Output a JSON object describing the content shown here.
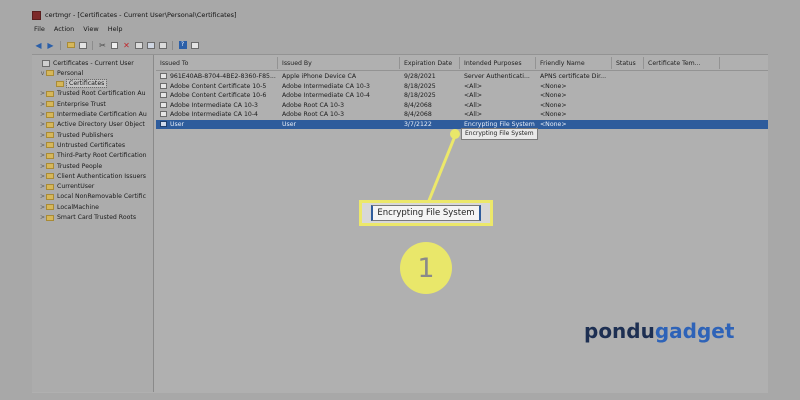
{
  "window": {
    "title": "certmgr - [Certificates - Current User\\Personal\\Certificates]",
    "menu": [
      "File",
      "Action",
      "View",
      "Help"
    ]
  },
  "toolbar_icons": [
    "back-icon",
    "forward-icon",
    "up-folder-icon",
    "show-hide-tree-icon",
    "cut-icon",
    "copy-icon",
    "delete-icon",
    "properties-icon",
    "refresh-icon",
    "export-icon",
    "help-icon",
    "view-icon"
  ],
  "tree": [
    {
      "label": "Certificates - Current User",
      "level": 0,
      "expander": "",
      "icon": "certificate-store-icon"
    },
    {
      "label": "Personal",
      "level": 1,
      "expander": "v",
      "icon": "folder-icon"
    },
    {
      "label": "Certificates",
      "level": 2,
      "expander": "",
      "icon": "folder-icon",
      "selected": true
    },
    {
      "label": "Trusted Root Certification Au",
      "level": 1,
      "expander": ">",
      "icon": "folder-icon"
    },
    {
      "label": "Enterprise Trust",
      "level": 1,
      "expander": ">",
      "icon": "folder-icon"
    },
    {
      "label": "Intermediate Certification Au",
      "level": 1,
      "expander": ">",
      "icon": "folder-icon"
    },
    {
      "label": "Active Directory User Object",
      "level": 1,
      "expander": ">",
      "icon": "folder-icon"
    },
    {
      "label": "Trusted Publishers",
      "level": 1,
      "expander": ">",
      "icon": "folder-icon"
    },
    {
      "label": "Untrusted Certificates",
      "level": 1,
      "expander": ">",
      "icon": "folder-icon"
    },
    {
      "label": "Third-Party Root Certification",
      "level": 1,
      "expander": ">",
      "icon": "folder-icon"
    },
    {
      "label": "Trusted People",
      "level": 1,
      "expander": ">",
      "icon": "folder-icon"
    },
    {
      "label": "Client Authentication Issuers",
      "level": 1,
      "expander": ">",
      "icon": "folder-icon"
    },
    {
      "label": "CurrentUser",
      "level": 1,
      "expander": ">",
      "icon": "folder-icon"
    },
    {
      "label": "Local NonRemovable Certific",
      "level": 1,
      "expander": ">",
      "icon": "folder-icon"
    },
    {
      "label": "LocalMachine",
      "level": 1,
      "expander": ">",
      "icon": "folder-icon"
    },
    {
      "label": "Smart Card Trusted Roots",
      "level": 1,
      "expander": ">",
      "icon": "folder-icon"
    }
  ],
  "table": {
    "columns": [
      "Issued To",
      "Issued By",
      "Expiration Date",
      "Intended Purposes",
      "Friendly Name",
      "Status",
      "Certificate Tem..."
    ],
    "rows": [
      [
        "961E40AB-8704-4BE2-8360-F85...",
        "Apple iPhone Device CA",
        "9/28/2021",
        "Server Authenticati...",
        "APNS certificate Dir...",
        "",
        ""
      ],
      [
        "Adobe Content Certificate 10-5",
        "Adobe Intermediate CA 10-3",
        "8/18/2025",
        "<All>",
        "<None>",
        "",
        ""
      ],
      [
        "Adobe Content Certificate 10-6",
        "Adobe Intermediate CA 10-4",
        "8/18/2025",
        "<All>",
        "<None>",
        "",
        ""
      ],
      [
        "Adobe Intermediate CA 10-3",
        "Adobe Root CA 10-3",
        "8/4/2068",
        "<All>",
        "<None>",
        "",
        ""
      ],
      [
        "Adobe Intermediate CA 10-4",
        "Adobe Root CA 10-3",
        "8/4/2068",
        "<All>",
        "<None>",
        "",
        ""
      ],
      [
        "User",
        "User",
        "3/7/2122",
        "Encrypting File System",
        "<None>",
        "",
        ""
      ]
    ],
    "selected_row": 5
  },
  "tooltip": "Encrypting File System",
  "callout": {
    "text": "Encrypting File System",
    "step": "1"
  },
  "logo": {
    "part1": "pondu",
    "part2": "gadget"
  },
  "colors": {
    "selection": "#2e5c9c",
    "highlight": "#e9e76a",
    "logo_dark": "#1d2f52",
    "logo_blue": "#2e63b8"
  }
}
